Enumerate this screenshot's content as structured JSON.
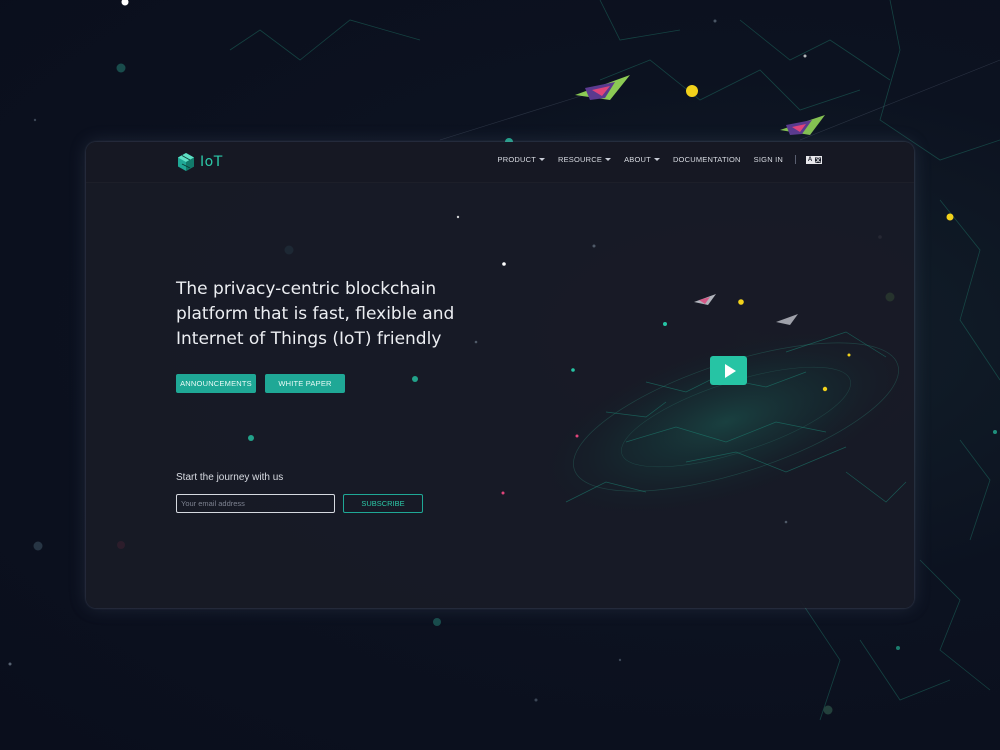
{
  "header": {
    "logo_text": "IoT",
    "nav": [
      {
        "label": "PRODUCT",
        "has_dropdown": true
      },
      {
        "label": "RESOURCE",
        "has_dropdown": true
      },
      {
        "label": "ABOUT",
        "has_dropdown": true
      },
      {
        "label": "DOCUMENTATION",
        "has_dropdown": false
      },
      {
        "label": "SIGN IN",
        "has_dropdown": false
      }
    ],
    "language_icon": "language-switch-icon"
  },
  "hero": {
    "headline": "The privacy-centric blockchain platform that is fast, flexible and Internet of Things (IoT) friendly",
    "buttons": {
      "announcements": "ANNOUNCEMENTS",
      "white_paper": "WHITE PAPER"
    }
  },
  "subscribe": {
    "title": "Start the journey with us",
    "email_placeholder": "Your email address",
    "button": "SUBSCRIBE"
  },
  "video": {
    "icon": "play-icon"
  },
  "colors": {
    "accent": "#1fa896",
    "accent_light": "#2cc9a8",
    "background": "#0b0f1e",
    "panel": "#181b26",
    "star_yellow": "#f2d21b",
    "star_pink": "#e0447a"
  }
}
